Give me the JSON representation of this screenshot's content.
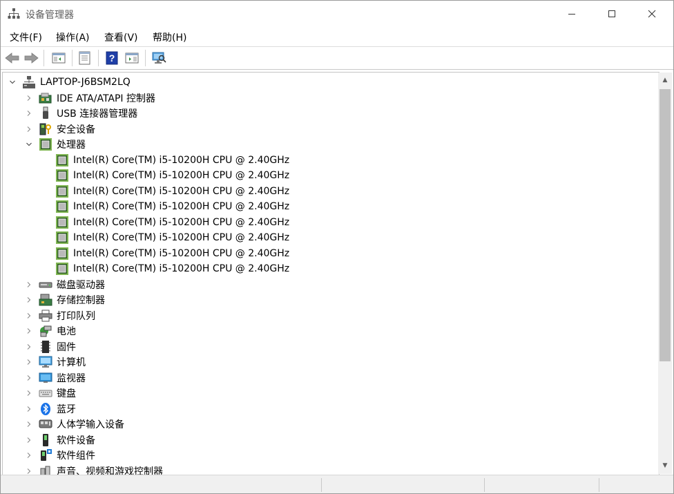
{
  "window": {
    "title": "设备管理器"
  },
  "menu": [
    "文件(F)",
    "操作(A)",
    "查看(V)",
    "帮助(H)"
  ],
  "toolbar": [
    "back-icon",
    "forward-icon",
    "show-hide-console-tree-icon",
    "properties-icon",
    "help-icon",
    "action-pane-icon",
    "scan-hardware-icon"
  ],
  "tree": {
    "root": {
      "label": "LAPTOP-J6BSM2LQ",
      "expanded": true
    },
    "nodes": [
      {
        "label": "IDE ATA/ATAPI 控制器",
        "icon": "ide-controller-icon",
        "expanded": false
      },
      {
        "label": "USB 连接器管理器",
        "icon": "usb-connector-icon",
        "expanded": false
      },
      {
        "label": "安全设备",
        "icon": "security-device-icon",
        "expanded": false
      },
      {
        "label": "处理器",
        "icon": "processor-icon",
        "expanded": true,
        "children": [
          "Intel(R) Core(TM) i5-10200H CPU @ 2.40GHz",
          "Intel(R) Core(TM) i5-10200H CPU @ 2.40GHz",
          "Intel(R) Core(TM) i5-10200H CPU @ 2.40GHz",
          "Intel(R) Core(TM) i5-10200H CPU @ 2.40GHz",
          "Intel(R) Core(TM) i5-10200H CPU @ 2.40GHz",
          "Intel(R) Core(TM) i5-10200H CPU @ 2.40GHz",
          "Intel(R) Core(TM) i5-10200H CPU @ 2.40GHz",
          "Intel(R) Core(TM) i5-10200H CPU @ 2.40GHz"
        ]
      },
      {
        "label": "磁盘驱动器",
        "icon": "disk-drive-icon",
        "expanded": false
      },
      {
        "label": "存储控制器",
        "icon": "storage-controller-icon",
        "expanded": false
      },
      {
        "label": "打印队列",
        "icon": "printer-icon",
        "expanded": false
      },
      {
        "label": "电池",
        "icon": "battery-icon",
        "expanded": false
      },
      {
        "label": "固件",
        "icon": "firmware-icon",
        "expanded": false
      },
      {
        "label": "计算机",
        "icon": "computer-icon",
        "expanded": false
      },
      {
        "label": "监视器",
        "icon": "monitor-icon",
        "expanded": false
      },
      {
        "label": "键盘",
        "icon": "keyboard-icon",
        "expanded": false
      },
      {
        "label": "蓝牙",
        "icon": "bluetooth-icon",
        "expanded": false
      },
      {
        "label": "人体学输入设备",
        "icon": "hid-icon",
        "expanded": false
      },
      {
        "label": "软件设备",
        "icon": "software-device-icon",
        "expanded": false
      },
      {
        "label": "软件组件",
        "icon": "software-component-icon",
        "expanded": false
      },
      {
        "label": "声音、视频和游戏控制器",
        "icon": "sound-icon",
        "expanded": false
      }
    ]
  }
}
